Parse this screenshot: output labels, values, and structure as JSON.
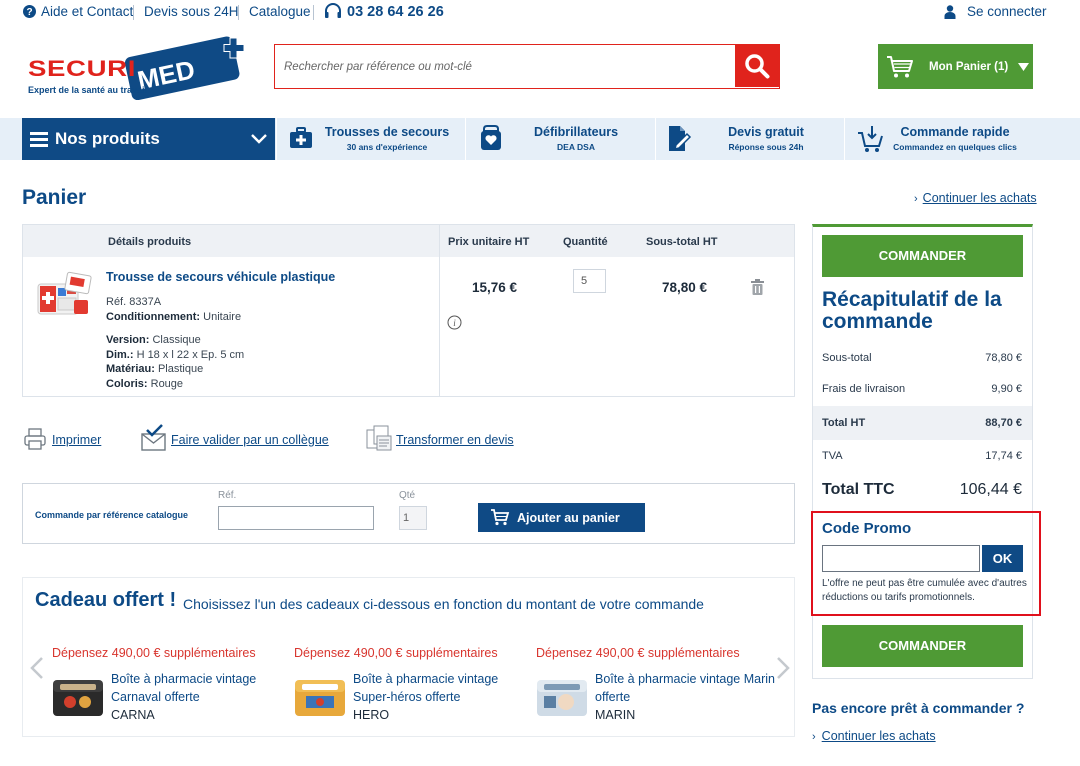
{
  "topbar": {
    "help": "Aide et Contact",
    "quote": "Devis sous 24H",
    "catalog": "Catalogue",
    "phone": "03 28 64 26 26",
    "login": "Se connecter"
  },
  "logo": {
    "brand": "SECURIMED",
    "tagline": "Expert de la santé au travail"
  },
  "search": {
    "placeholder": "Rechercher par référence ou mot-clé"
  },
  "cart": {
    "label": "Mon Panier (1)"
  },
  "nav": {
    "products": "Nos produits",
    "items": [
      {
        "title": "Trousses de secours",
        "subtitle": "30 ans d'expérience"
      },
      {
        "title": "Défibrillateurs",
        "subtitle": "DEA DSA"
      },
      {
        "title": "Devis gratuit",
        "subtitle": "Réponse sous 24h"
      },
      {
        "title": "Commande rapide",
        "subtitle": "Commandez en quelques clics"
      }
    ]
  },
  "page": {
    "title": "Panier",
    "continue": "Continuer les achats"
  },
  "table": {
    "headers": [
      "Détails produits",
      "Prix unitaire HT",
      "Quantité",
      "Sous-total HT"
    ],
    "product": {
      "name": "Trousse de secours véhicule plastique",
      "ref": "Réf. 8337A",
      "conditioning_label": "Conditionnement:",
      "conditioning": "Unitaire",
      "version_label": "Version:",
      "version": "Classique",
      "dim_label": "Dim.:",
      "dim": "H 18 x l 22 x Ep. 5 cm",
      "material_label": "Matériau:",
      "material": "Plastique",
      "color_label": "Coloris:",
      "color": "Rouge",
      "unit_price": "15,76 €",
      "quantity": "5",
      "subtotal": "78,80 €"
    }
  },
  "actions": {
    "print": "Imprimer",
    "validate": "Faire valider par un collègue",
    "quote": "Transformer en devis"
  },
  "quick_order": {
    "label": "Commande par référence catalogue",
    "ref_label": "Réf.",
    "qty_label": "Qté",
    "qty_value": "1",
    "button": "Ajouter au panier"
  },
  "gift": {
    "title": "Cadeau offert !",
    "subtitle": "Choisissez l'un des cadeaux ci-dessous en fonction du montant de votre commande",
    "items": [
      {
        "spend": "Dépensez 490,00 € supplémentaires",
        "line1": "Boîte à pharmacie vintage",
        "line2": "Carnaval offerte",
        "code": "CARNA"
      },
      {
        "spend": "Dépensez 490,00 € supplémentaires",
        "line1": "Boîte à pharmacie vintage",
        "line2": "Super-héros offerte",
        "code": "HERO"
      },
      {
        "spend": "Dépensez 490,00 € supplémentaires",
        "line1": "Boîte à pharmacie vintage Marin",
        "line2": "offerte",
        "code": "MARIN"
      }
    ]
  },
  "summary": {
    "order_button": "COMMANDER",
    "title": "Récapitulatif de la commande",
    "rows": [
      {
        "label": "Sous-total",
        "value": "78,80 €"
      },
      {
        "label": "Frais de livraison",
        "value": "9,90 €"
      },
      {
        "label": "Total HT",
        "value": "88,70 €"
      },
      {
        "label": "TVA",
        "value": "17,74 €"
      }
    ],
    "total_label": "Total TTC",
    "total_value": "106,44 €",
    "promo_title": "Code Promo",
    "promo_ok": "OK",
    "promo_note": "L'offre ne peut pas être cumulée avec d'autres réductions ou tarifs promotionnels.",
    "not_ready": "Pas encore prêt à commander ?",
    "continue": "Continuer les achats"
  },
  "colors": {
    "brand_blue": "#0f4a85",
    "green": "#4f9a35",
    "red": "#e0231c"
  }
}
